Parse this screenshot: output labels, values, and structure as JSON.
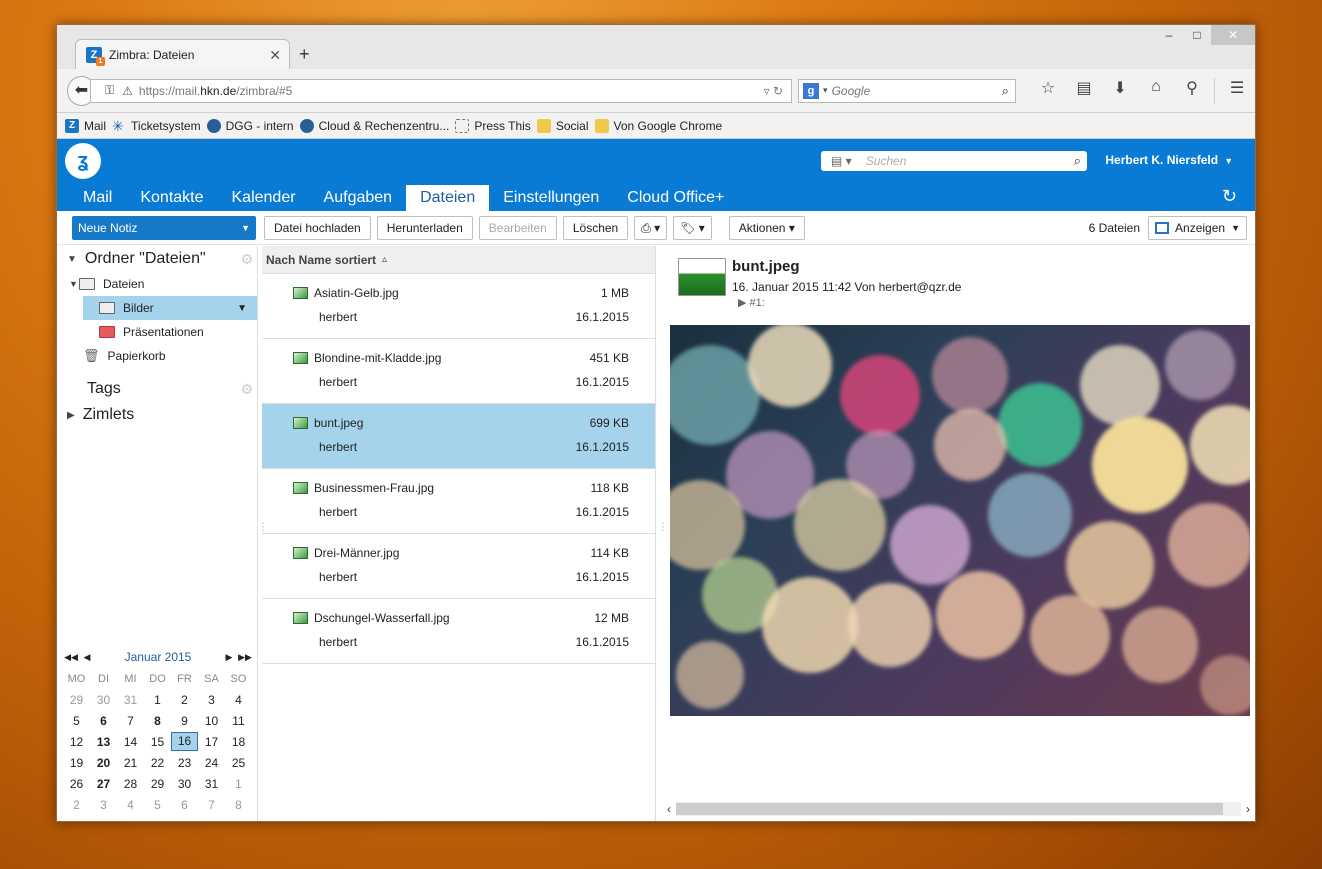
{
  "browser": {
    "tab_title": "Zimbra: Dateien",
    "new_tab": "+",
    "url_prefix": "https://mail.",
    "url_domain": "hkn.de",
    "url_path": "/zimbra/#5",
    "search_placeholder": "Google",
    "window_controls": {
      "minimize": "–",
      "maximize": "□",
      "close": "✕"
    }
  },
  "bookmarks": [
    {
      "label": "Mail",
      "icon": "zimbra-icon"
    },
    {
      "label": "Ticketsystem",
      "icon": "star-icon"
    },
    {
      "label": "DGG - intern",
      "icon": "globe-icon"
    },
    {
      "label": "Cloud & Rechenzentru...",
      "icon": "globe-icon"
    },
    {
      "label": "Press This",
      "icon": "dashed-box-icon"
    },
    {
      "label": "Social",
      "icon": "folder-icon"
    },
    {
      "label": "Von Google Chrome",
      "icon": "folder-icon"
    }
  ],
  "zimbra": {
    "search_placeholder": "Suchen",
    "user": "Herbert K. Niersfeld",
    "tabs": [
      "Mail",
      "Kontakte",
      "Kalender",
      "Aufgaben",
      "Dateien",
      "Einstellungen",
      "Cloud Office+"
    ],
    "active_tab": "Dateien"
  },
  "toolbar": {
    "new_button": "Neue Notiz",
    "upload": "Datei hochladen",
    "download": "Herunterladen",
    "edit": "Bearbeiten",
    "delete": "Löschen",
    "actions": "Aktionen",
    "file_count": "6 Dateien",
    "view": "Anzeigen"
  },
  "sidebar": {
    "folder_header": "Ordner \"Dateien\"",
    "root": "Dateien",
    "selected": "Bilder",
    "sub": "Präsentationen",
    "trash": "Papierkorb",
    "tags": "Tags",
    "zimlets": "Zimlets"
  },
  "calendar": {
    "month": "Januar 2015",
    "days": [
      "MO",
      "DI",
      "MI",
      "DO",
      "FR",
      "SA",
      "SO"
    ],
    "weeks": [
      [
        "29",
        "30",
        "31",
        "1",
        "2",
        "3",
        "4"
      ],
      [
        "5",
        "6",
        "7",
        "8",
        "9",
        "10",
        "11"
      ],
      [
        "12",
        "13",
        "14",
        "15",
        "16",
        "17",
        "18"
      ],
      [
        "19",
        "20",
        "21",
        "22",
        "23",
        "24",
        "25"
      ],
      [
        "26",
        "27",
        "28",
        "29",
        "30",
        "31",
        "1"
      ],
      [
        "2",
        "3",
        "4",
        "5",
        "6",
        "7",
        "8"
      ]
    ]
  },
  "list": {
    "header": "Nach Name sortiert",
    "files": [
      {
        "name": "Asiatin-Gelb.jpg",
        "size": "1 MB",
        "owner": "herbert",
        "date": "16.1.2015"
      },
      {
        "name": "Blondine-mit-Kladde.jpg",
        "size": "451 KB",
        "owner": "herbert",
        "date": "16.1.2015"
      },
      {
        "name": "bunt.jpeg",
        "size": "699 KB",
        "owner": "herbert",
        "date": "16.1.2015"
      },
      {
        "name": "Businessmen-Frau.jpg",
        "size": "118 KB",
        "owner": "herbert",
        "date": "16.1.2015"
      },
      {
        "name": "Drei-Männer.jpg",
        "size": "114 KB",
        "owner": "herbert",
        "date": "16.1.2015"
      },
      {
        "name": "Dschungel-Wasserfall.jpg",
        "size": "12 MB",
        "owner": "herbert",
        "date": "16.1.2015"
      }
    ]
  },
  "preview": {
    "title": "bunt.jpeg",
    "meta": "16. Januar 2015 11:42 Von herbert@qzr.de",
    "version": "#1:"
  }
}
